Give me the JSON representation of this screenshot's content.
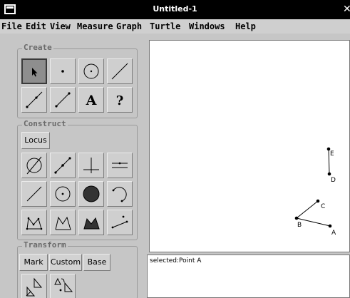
{
  "window": {
    "title": "Untitled-1"
  },
  "menu": [
    "File",
    "Edit",
    "View",
    "Measure",
    "Graph",
    "Turtle",
    "Windows",
    "Help"
  ],
  "panels": {
    "create": {
      "title": "Create",
      "text_tool": "A",
      "help_tool": "?"
    },
    "construct": {
      "title": "Construct",
      "locus_label": "Locus"
    },
    "transform": {
      "title": "Transform",
      "mark_label": "Mark",
      "custom_label": "Custom",
      "base_label": "Base"
    }
  },
  "canvas": {
    "points": [
      {
        "label": "E"
      },
      {
        "label": "D"
      },
      {
        "label": "C"
      },
      {
        "label": "B"
      },
      {
        "label": "A"
      }
    ]
  },
  "status": {
    "text": "selected:Point A"
  }
}
